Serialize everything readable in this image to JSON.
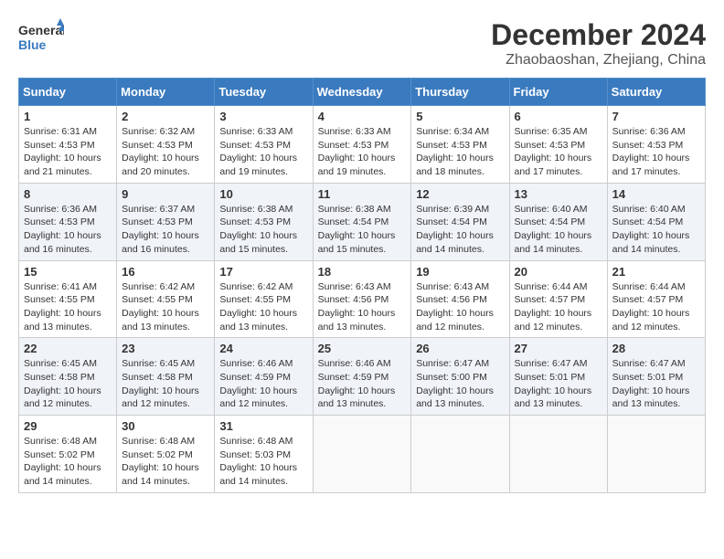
{
  "header": {
    "logo_text1": "General",
    "logo_text2": "Blue",
    "month_title": "December 2024",
    "location": "Zhaobaoshan, Zhejiang, China"
  },
  "days_of_week": [
    "Sunday",
    "Monday",
    "Tuesday",
    "Wednesday",
    "Thursday",
    "Friday",
    "Saturday"
  ],
  "weeks": [
    [
      {
        "day": 1,
        "lines": [
          "Sunrise: 6:31 AM",
          "Sunset: 4:53 PM",
          "Daylight: 10 hours",
          "and 21 minutes."
        ]
      },
      {
        "day": 2,
        "lines": [
          "Sunrise: 6:32 AM",
          "Sunset: 4:53 PM",
          "Daylight: 10 hours",
          "and 20 minutes."
        ]
      },
      {
        "day": 3,
        "lines": [
          "Sunrise: 6:33 AM",
          "Sunset: 4:53 PM",
          "Daylight: 10 hours",
          "and 19 minutes."
        ]
      },
      {
        "day": 4,
        "lines": [
          "Sunrise: 6:33 AM",
          "Sunset: 4:53 PM",
          "Daylight: 10 hours",
          "and 19 minutes."
        ]
      },
      {
        "day": 5,
        "lines": [
          "Sunrise: 6:34 AM",
          "Sunset: 4:53 PM",
          "Daylight: 10 hours",
          "and 18 minutes."
        ]
      },
      {
        "day": 6,
        "lines": [
          "Sunrise: 6:35 AM",
          "Sunset: 4:53 PM",
          "Daylight: 10 hours",
          "and 17 minutes."
        ]
      },
      {
        "day": 7,
        "lines": [
          "Sunrise: 6:36 AM",
          "Sunset: 4:53 PM",
          "Daylight: 10 hours",
          "and 17 minutes."
        ]
      }
    ],
    [
      {
        "day": 8,
        "lines": [
          "Sunrise: 6:36 AM",
          "Sunset: 4:53 PM",
          "Daylight: 10 hours",
          "and 16 minutes."
        ]
      },
      {
        "day": 9,
        "lines": [
          "Sunrise: 6:37 AM",
          "Sunset: 4:53 PM",
          "Daylight: 10 hours",
          "and 16 minutes."
        ]
      },
      {
        "day": 10,
        "lines": [
          "Sunrise: 6:38 AM",
          "Sunset: 4:53 PM",
          "Daylight: 10 hours",
          "and 15 minutes."
        ]
      },
      {
        "day": 11,
        "lines": [
          "Sunrise: 6:38 AM",
          "Sunset: 4:54 PM",
          "Daylight: 10 hours",
          "and 15 minutes."
        ]
      },
      {
        "day": 12,
        "lines": [
          "Sunrise: 6:39 AM",
          "Sunset: 4:54 PM",
          "Daylight: 10 hours",
          "and 14 minutes."
        ]
      },
      {
        "day": 13,
        "lines": [
          "Sunrise: 6:40 AM",
          "Sunset: 4:54 PM",
          "Daylight: 10 hours",
          "and 14 minutes."
        ]
      },
      {
        "day": 14,
        "lines": [
          "Sunrise: 6:40 AM",
          "Sunset: 4:54 PM",
          "Daylight: 10 hours",
          "and 14 minutes."
        ]
      }
    ],
    [
      {
        "day": 15,
        "lines": [
          "Sunrise: 6:41 AM",
          "Sunset: 4:55 PM",
          "Daylight: 10 hours",
          "and 13 minutes."
        ]
      },
      {
        "day": 16,
        "lines": [
          "Sunrise: 6:42 AM",
          "Sunset: 4:55 PM",
          "Daylight: 10 hours",
          "and 13 minutes."
        ]
      },
      {
        "day": 17,
        "lines": [
          "Sunrise: 6:42 AM",
          "Sunset: 4:55 PM",
          "Daylight: 10 hours",
          "and 13 minutes."
        ]
      },
      {
        "day": 18,
        "lines": [
          "Sunrise: 6:43 AM",
          "Sunset: 4:56 PM",
          "Daylight: 10 hours",
          "and 13 minutes."
        ]
      },
      {
        "day": 19,
        "lines": [
          "Sunrise: 6:43 AM",
          "Sunset: 4:56 PM",
          "Daylight: 10 hours",
          "and 12 minutes."
        ]
      },
      {
        "day": 20,
        "lines": [
          "Sunrise: 6:44 AM",
          "Sunset: 4:57 PM",
          "Daylight: 10 hours",
          "and 12 minutes."
        ]
      },
      {
        "day": 21,
        "lines": [
          "Sunrise: 6:44 AM",
          "Sunset: 4:57 PM",
          "Daylight: 10 hours",
          "and 12 minutes."
        ]
      }
    ],
    [
      {
        "day": 22,
        "lines": [
          "Sunrise: 6:45 AM",
          "Sunset: 4:58 PM",
          "Daylight: 10 hours",
          "and 12 minutes."
        ]
      },
      {
        "day": 23,
        "lines": [
          "Sunrise: 6:45 AM",
          "Sunset: 4:58 PM",
          "Daylight: 10 hours",
          "and 12 minutes."
        ]
      },
      {
        "day": 24,
        "lines": [
          "Sunrise: 6:46 AM",
          "Sunset: 4:59 PM",
          "Daylight: 10 hours",
          "and 12 minutes."
        ]
      },
      {
        "day": 25,
        "lines": [
          "Sunrise: 6:46 AM",
          "Sunset: 4:59 PM",
          "Daylight: 10 hours",
          "and 13 minutes."
        ]
      },
      {
        "day": 26,
        "lines": [
          "Sunrise: 6:47 AM",
          "Sunset: 5:00 PM",
          "Daylight: 10 hours",
          "and 13 minutes."
        ]
      },
      {
        "day": 27,
        "lines": [
          "Sunrise: 6:47 AM",
          "Sunset: 5:01 PM",
          "Daylight: 10 hours",
          "and 13 minutes."
        ]
      },
      {
        "day": 28,
        "lines": [
          "Sunrise: 6:47 AM",
          "Sunset: 5:01 PM",
          "Daylight: 10 hours",
          "and 13 minutes."
        ]
      }
    ],
    [
      {
        "day": 29,
        "lines": [
          "Sunrise: 6:48 AM",
          "Sunset: 5:02 PM",
          "Daylight: 10 hours",
          "and 14 minutes."
        ]
      },
      {
        "day": 30,
        "lines": [
          "Sunrise: 6:48 AM",
          "Sunset: 5:02 PM",
          "Daylight: 10 hours",
          "and 14 minutes."
        ]
      },
      {
        "day": 31,
        "lines": [
          "Sunrise: 6:48 AM",
          "Sunset: 5:03 PM",
          "Daylight: 10 hours",
          "and 14 minutes."
        ]
      },
      null,
      null,
      null,
      null
    ]
  ]
}
